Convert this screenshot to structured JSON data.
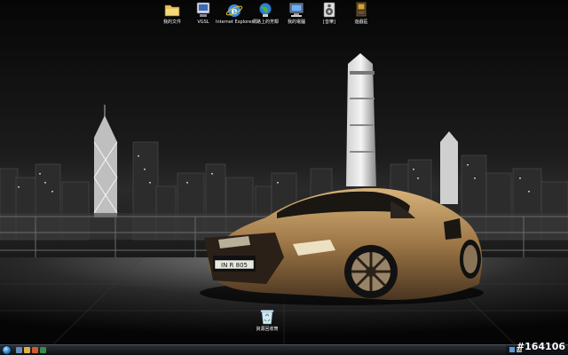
{
  "desktop_icons": [
    {
      "label": "我的文件",
      "icon": "folder-icon"
    },
    {
      "label": "VGSL",
      "icon": "program-icon"
    },
    {
      "label": "Internet Explorer",
      "icon": "ie-icon"
    },
    {
      "label": "網路上的芳鄰",
      "icon": "network-icon"
    },
    {
      "label": "我的電腦",
      "icon": "computer-icon"
    },
    {
      "label": "[音樂]",
      "icon": "music-icon"
    },
    {
      "label": "遊戲區",
      "icon": "games-icon"
    }
  ],
  "recycle_bin": {
    "label": "資源回收筒",
    "icon": "recycle-bin-icon"
  },
  "wallpaper": {
    "plate_text": "IN R 805",
    "accent": "#b08a5a"
  },
  "taskbar": {
    "start_icon": "windows-orb-icon"
  },
  "watermark": "#164106"
}
